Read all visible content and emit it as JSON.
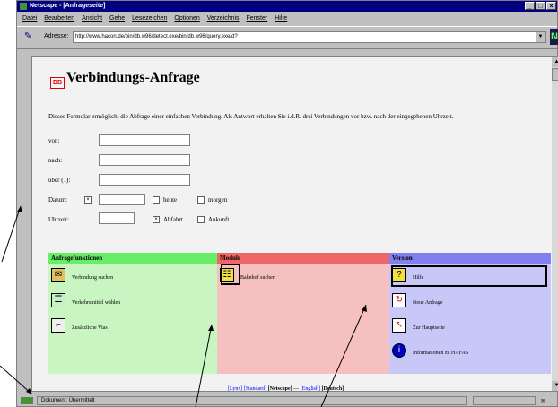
{
  "window": {
    "title": "Netscape - [Anfrageseite]",
    "min_glyph": "_",
    "max_glyph": "□",
    "close_glyph": "×"
  },
  "menu": [
    "Datei",
    "Bearbeiten",
    "Ansicht",
    "Gehe",
    "Lesezeichen",
    "Optionen",
    "Verzeichnis",
    "Fenster",
    "Hilfe"
  ],
  "address": {
    "label": "Adresse:",
    "url": "http://www.hacon.de/bin/db.w96/detect.exe/bin/db.w96/query.exe/d?",
    "dropdown_glyph": "▼",
    "logo_letter": "N"
  },
  "page": {
    "db_logo": "DB",
    "title": "Verbindungs-Anfrage",
    "intro": "Dieses Formular ermöglicht die Abfrage einer einfachen Verbindung. Als Antwort erhalten Sie i.d.R. drei Verbindungen vor bzw. nach der eingegebenen Uhrzeit.",
    "form": {
      "von": "von:",
      "nach": "nach:",
      "ueber": "über (1):",
      "datum": "Datum:",
      "heute": "heute",
      "morgen": "morgen",
      "uhrzeit": "Uhrzeit:",
      "abfahrt": "Abfahrt",
      "ankunft": "Ankunft",
      "checked_glyph": "×"
    },
    "panels": {
      "anfrage": {
        "header": "Anfragefunktionen",
        "items": [
          "Verbindung suchen",
          "Verkehrsmittel wählen",
          "Zusätzliche Vias"
        ]
      },
      "module": {
        "header": "Module",
        "items": [
          "Bahnhof suchen"
        ]
      },
      "version": {
        "header": "Version",
        "items": [
          "Hilfe",
          "Neue Anfrage",
          "Zur Hauptseite",
          "Informationen zu HAFAS"
        ]
      }
    },
    "footer": {
      "lynx": "[Lynx]",
      "standard": "[Standard]",
      "netscape": "[Netscape]",
      "sep": "---",
      "english": "[English]",
      "deutsch": "[Deutsch]"
    }
  },
  "status": {
    "text": "Dokument: Übermittelt"
  },
  "colors": {
    "green_panel": "#c8f5c0",
    "green_head": "#66ee66",
    "red_panel": "#f7c0c0",
    "red_head": "#ee6666",
    "blue_panel": "#c8c8f8",
    "blue_head": "#8080f0"
  }
}
